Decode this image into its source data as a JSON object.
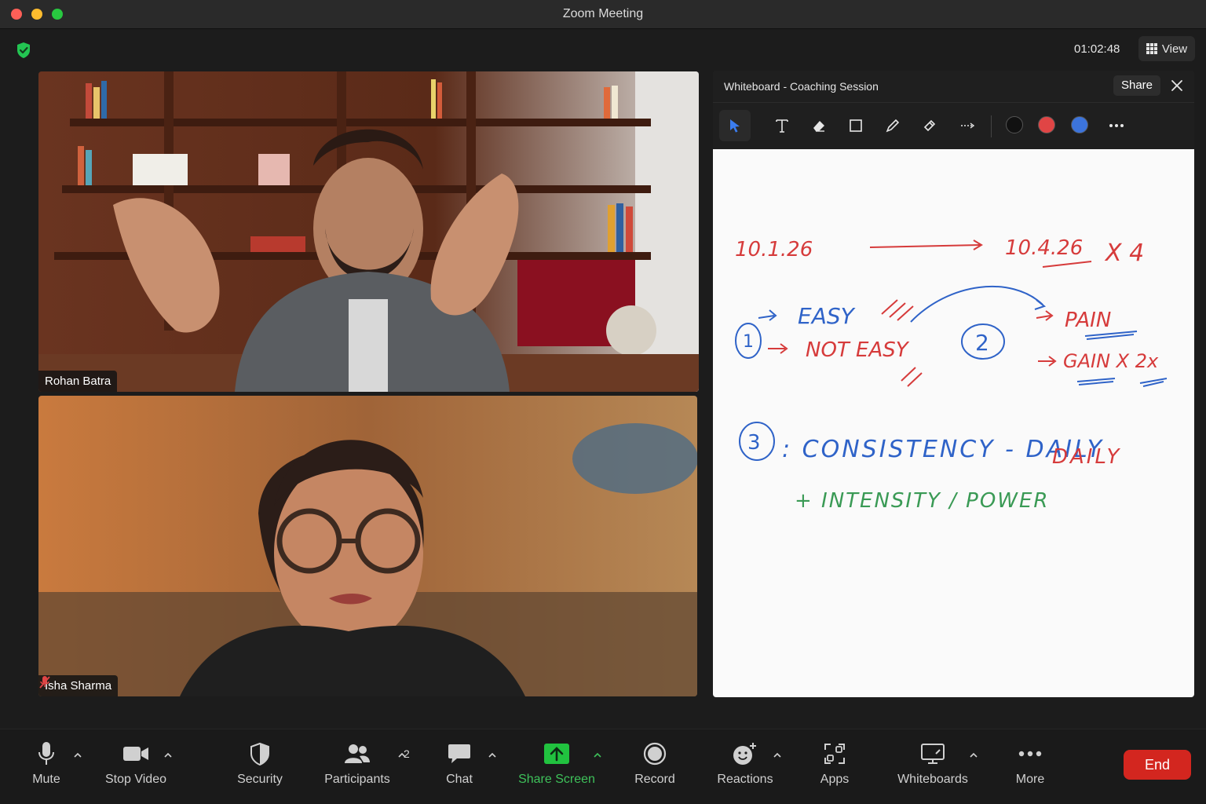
{
  "window": {
    "title": "Zoom Meeting"
  },
  "meeting": {
    "timer": "01:02:48",
    "view_label": "View"
  },
  "participants": [
    {
      "name": "Rohan Batra",
      "muted": false
    },
    {
      "name": "Isha Sharma",
      "muted": true
    }
  ],
  "whiteboard": {
    "title": "Whiteboard - Coaching Session",
    "share_label": "Share",
    "colors": [
      "#111111",
      "#e04545",
      "#3c74dc"
    ],
    "notes": {
      "date_start": "10.1.26",
      "date_end": "10.4.26",
      "multiplier": "X 4",
      "easy": "EASY",
      "not_easy": "NOT EASY",
      "pain": "PAIN",
      "gain": "GAIN X 2x",
      "consistency": ": CONSISTENCY - DAILY",
      "intensity": "+ INTENSITY / POWER",
      "step_1": "1",
      "step_2": "2",
      "step_3": "3"
    }
  },
  "toolbar": {
    "mute": "Mute",
    "stop_video": "Stop Video",
    "security": "Security",
    "participants": "Participants",
    "participants_count": "2",
    "chat": "Chat",
    "share_screen": "Share Screen",
    "record": "Record",
    "reactions": "Reactions",
    "apps": "Apps",
    "whiteboards": "Whiteboards",
    "more": "More",
    "end": "End"
  },
  "colors": {
    "accent_green": "#3ec15a",
    "end_red": "#d3261f",
    "ink_red": "#d63b3b",
    "ink_blue": "#2f63c8",
    "ink_green": "#3a9a55"
  }
}
